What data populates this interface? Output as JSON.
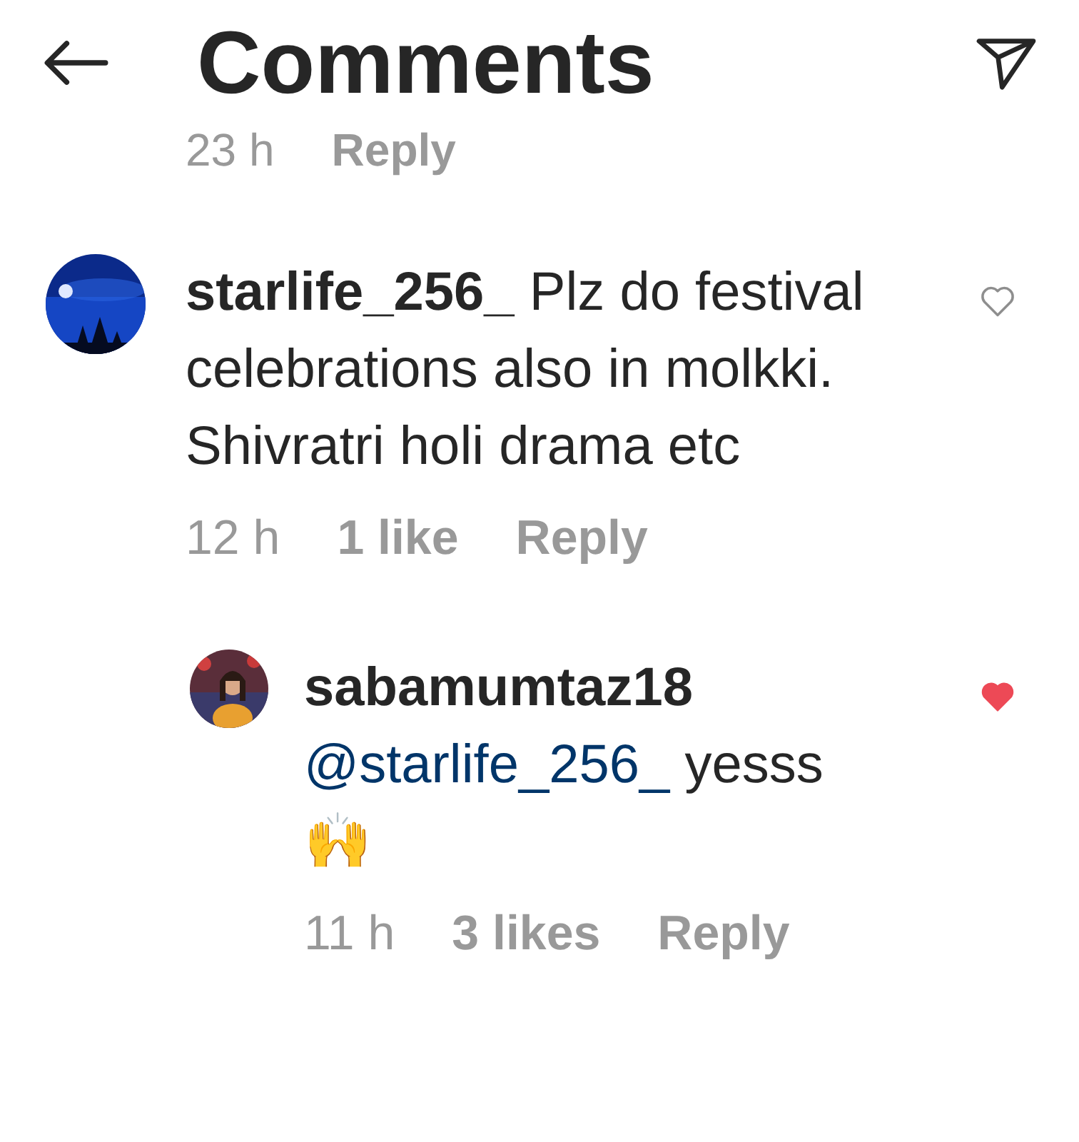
{
  "header": {
    "title": "Comments"
  },
  "previous_comment_meta": {
    "time": "23 h",
    "reply": "Reply"
  },
  "comments": [
    {
      "username": "starlife_256_",
      "text": "Plz do festival celebrations also in molkki. Shivratri holi drama etc",
      "time": "12 h",
      "likes": "1 like",
      "reply": "Reply",
      "liked": false,
      "replies": [
        {
          "username": "sabamumtaz18",
          "mention": "@starlife_256_",
          "text": "yesss",
          "emoji": "🙌",
          "time": "11 h",
          "likes": "3 likes",
          "reply": "Reply",
          "liked": true
        }
      ]
    }
  ]
}
